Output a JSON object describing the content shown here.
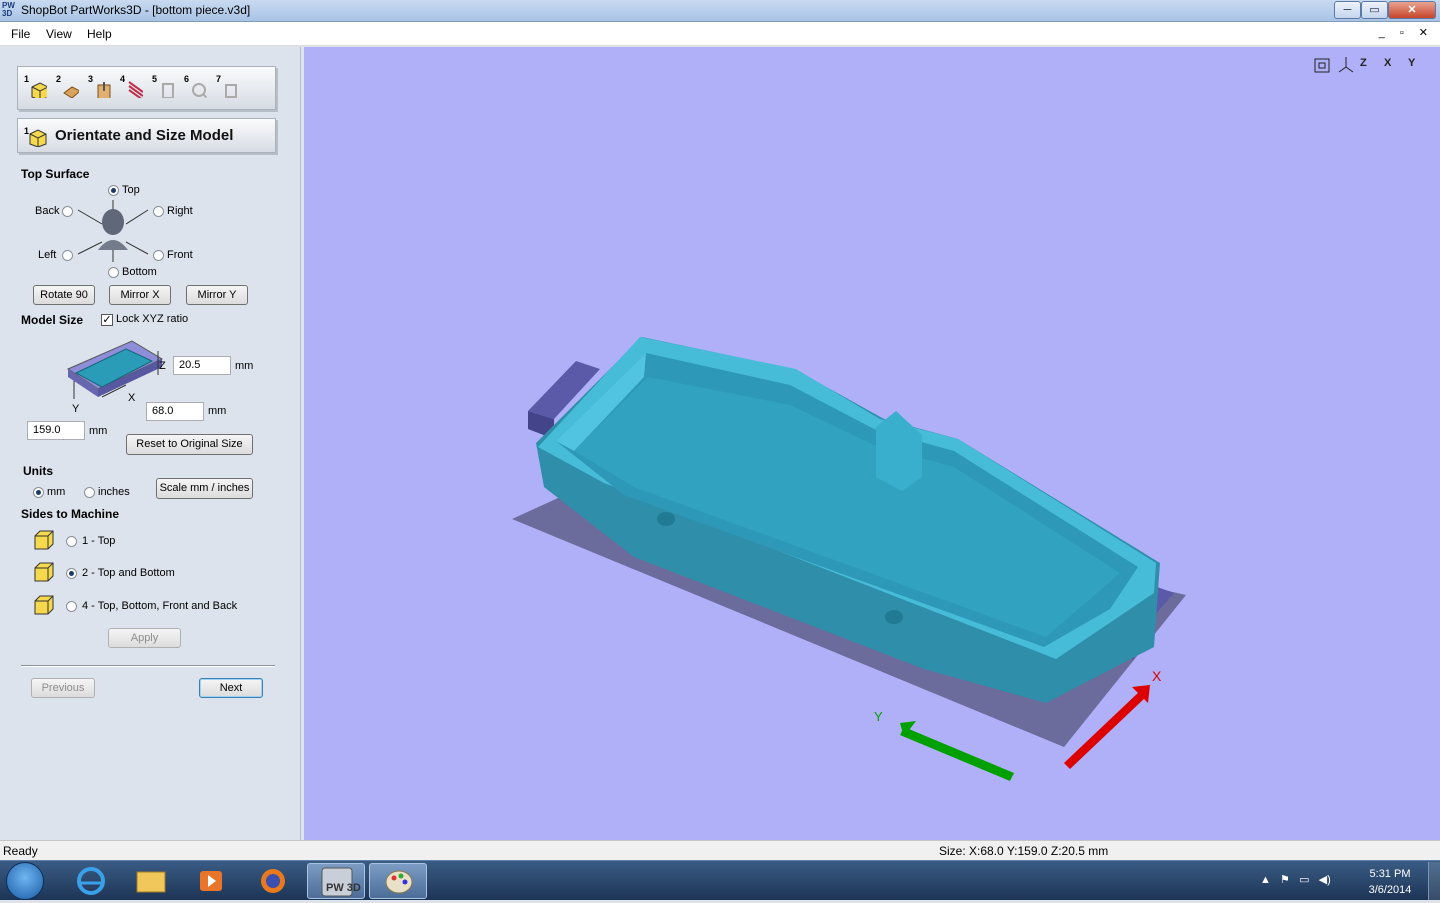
{
  "window": {
    "title": "ShopBot PartWorks3D - [bottom piece.v3d]",
    "app_icon_text": "PW 3D",
    "min": "─",
    "max": "▭",
    "close": "✕"
  },
  "menu": {
    "file": "File",
    "view": "View",
    "help": "Help",
    "mdi": "_ ▫ ✕"
  },
  "steps": [
    "1",
    "2",
    "3",
    "4",
    "5",
    "6",
    "7"
  ],
  "step_header": {
    "number": "1",
    "title": "Orientate and Size Model"
  },
  "top_surface": {
    "heading": "Top Surface",
    "options": {
      "top": "Top",
      "back": "Back",
      "right": "Right",
      "left": "Left",
      "front": "Front",
      "bottom": "Bottom"
    },
    "selected": "Top",
    "buttons": {
      "rotate": "Rotate 90",
      "mirror_x": "Mirror X",
      "mirror_y": "Mirror Y"
    }
  },
  "model_size": {
    "heading": "Model Size",
    "lock_label": "Lock XYZ ratio",
    "lock_checked": true,
    "axis_z": "Z",
    "axis_x": "X",
    "axis_y": "Y",
    "z_value": "20.5",
    "x_value": "68.0",
    "y_value": "159.0",
    "unit": "mm",
    "reset": "Reset to Original Size"
  },
  "units": {
    "heading": "Units",
    "mm": "mm",
    "inches": "inches",
    "selected": "mm",
    "scale_button": "Scale mm / inches"
  },
  "sides": {
    "heading": "Sides to Machine",
    "options": [
      "1 - Top",
      "2 - Top and Bottom",
      "4 - Top, Bottom, Front and Back"
    ],
    "selected": "2 - Top and Bottom",
    "apply": "Apply"
  },
  "nav": {
    "previous": "Previous",
    "next": "Next"
  },
  "view_toolbar": [
    "Z",
    "X",
    "Y"
  ],
  "status": {
    "left": "Ready",
    "right": "Size: X:68.0 Y:159.0 Z:20.5 mm"
  },
  "axes": {
    "x_label": "X",
    "y_label": "Y"
  },
  "colors": {
    "viewport": "#b0b0f8",
    "model": "#3fb3d0",
    "x_axis": "#dd0000",
    "y_axis": "#00a000",
    "shadow": "#6b6b9c"
  },
  "taskbar": {
    "time": "5:31 PM",
    "date": "3/6/2014",
    "pw3d_label": "PW 3D"
  }
}
